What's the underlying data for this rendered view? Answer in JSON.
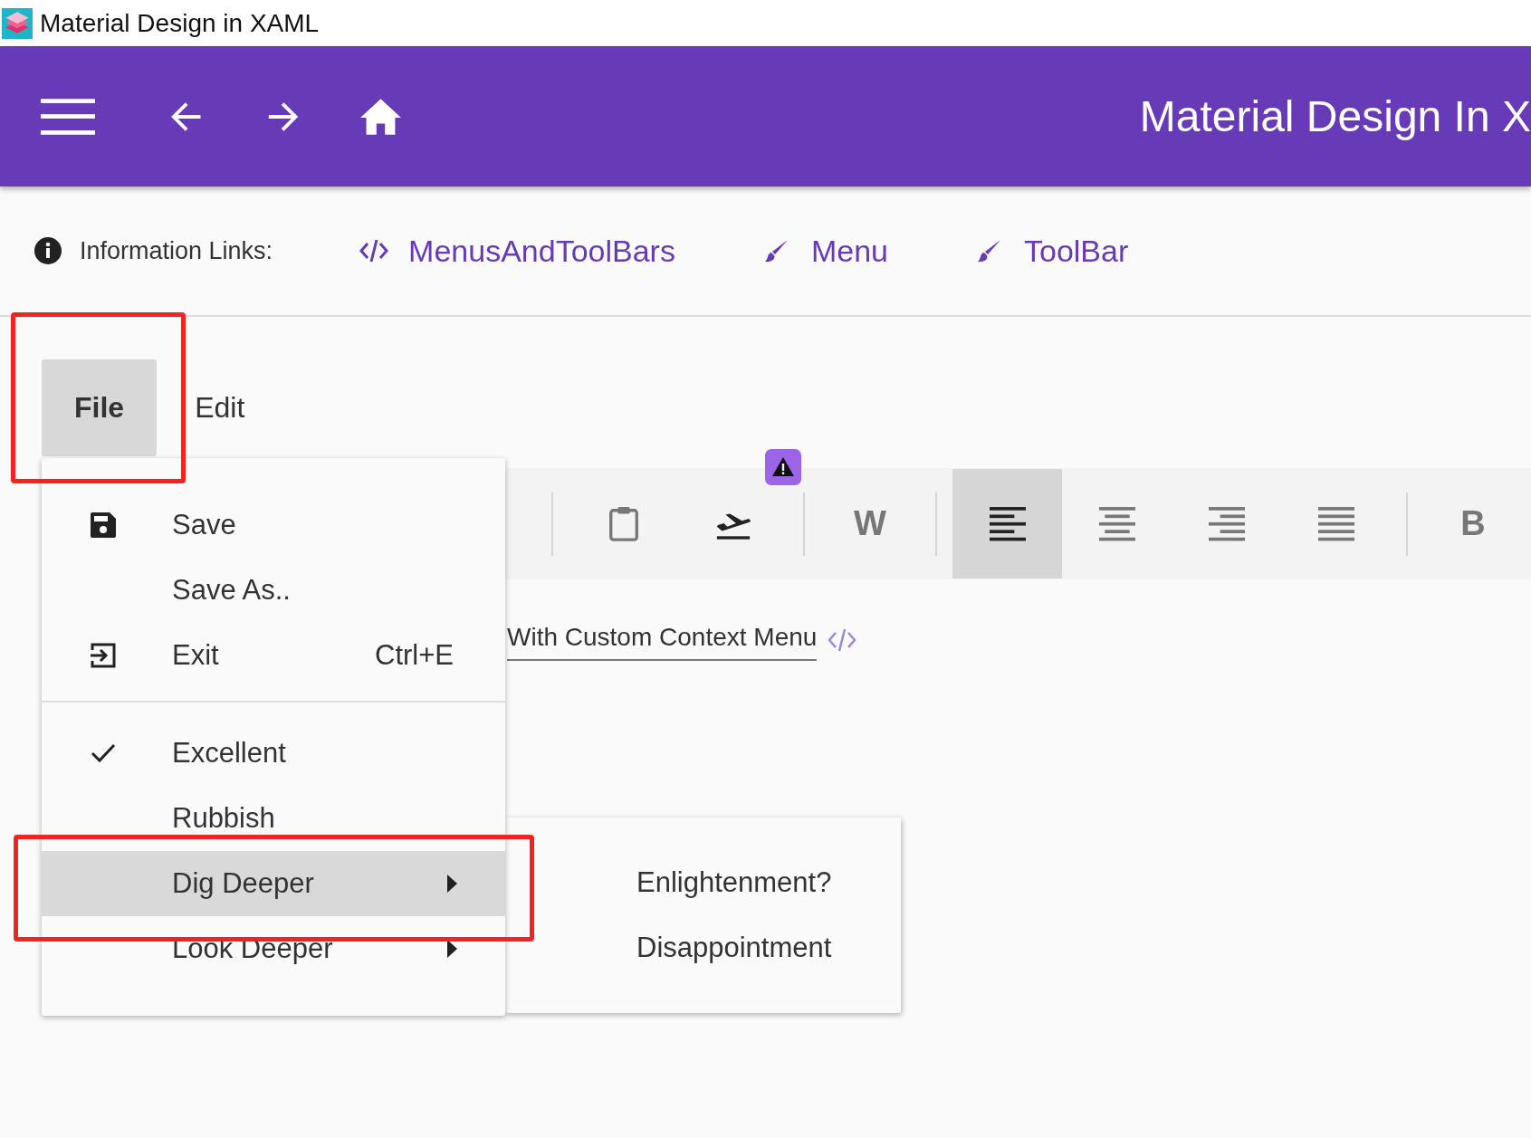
{
  "window": {
    "title": "Material Design in XAML"
  },
  "app_bar": {
    "title": "Material Design In X"
  },
  "info_links": {
    "label": "Information Links:",
    "links": [
      {
        "kind": "code",
        "label": "MenusAndToolBars"
      },
      {
        "kind": "brush",
        "label": "Menu"
      },
      {
        "kind": "brush",
        "label": "ToolBar"
      }
    ]
  },
  "menu_bar": [
    {
      "label": "File",
      "selected": true
    },
    {
      "label": "Edit",
      "selected": false
    }
  ],
  "toolbar": [
    {
      "kind": "separator"
    },
    {
      "kind": "clipboard"
    },
    {
      "kind": "takeoff"
    },
    {
      "kind": "separator"
    },
    {
      "kind": "text",
      "label": "W"
    },
    {
      "kind": "separator"
    },
    {
      "kind": "align-left",
      "selected": true
    },
    {
      "kind": "align-center",
      "selected": false
    },
    {
      "kind": "align-right",
      "selected": false
    },
    {
      "kind": "align-justify",
      "selected": false
    },
    {
      "kind": "separator"
    },
    {
      "kind": "text",
      "label": "B"
    }
  ],
  "text_field": {
    "value": "With Custom Context Menu"
  },
  "file_menu": [
    {
      "kind": "save",
      "label": "Save"
    },
    {
      "kind": "plain",
      "label": "Save As.."
    },
    {
      "kind": "exit",
      "label": "Exit",
      "shortcut": "Ctrl+E"
    },
    {
      "kind": "divider"
    },
    {
      "kind": "check",
      "label": "Excellent",
      "checked": true
    },
    {
      "kind": "check",
      "label": "Rubbish",
      "checked": false
    },
    {
      "kind": "submenu",
      "label": "Dig Deeper",
      "selected": true
    },
    {
      "kind": "submenu",
      "label": "Look Deeper",
      "selected": false
    }
  ],
  "submenu": [
    {
      "label": "Enlightenment?"
    },
    {
      "label": "Disappointment"
    }
  ]
}
